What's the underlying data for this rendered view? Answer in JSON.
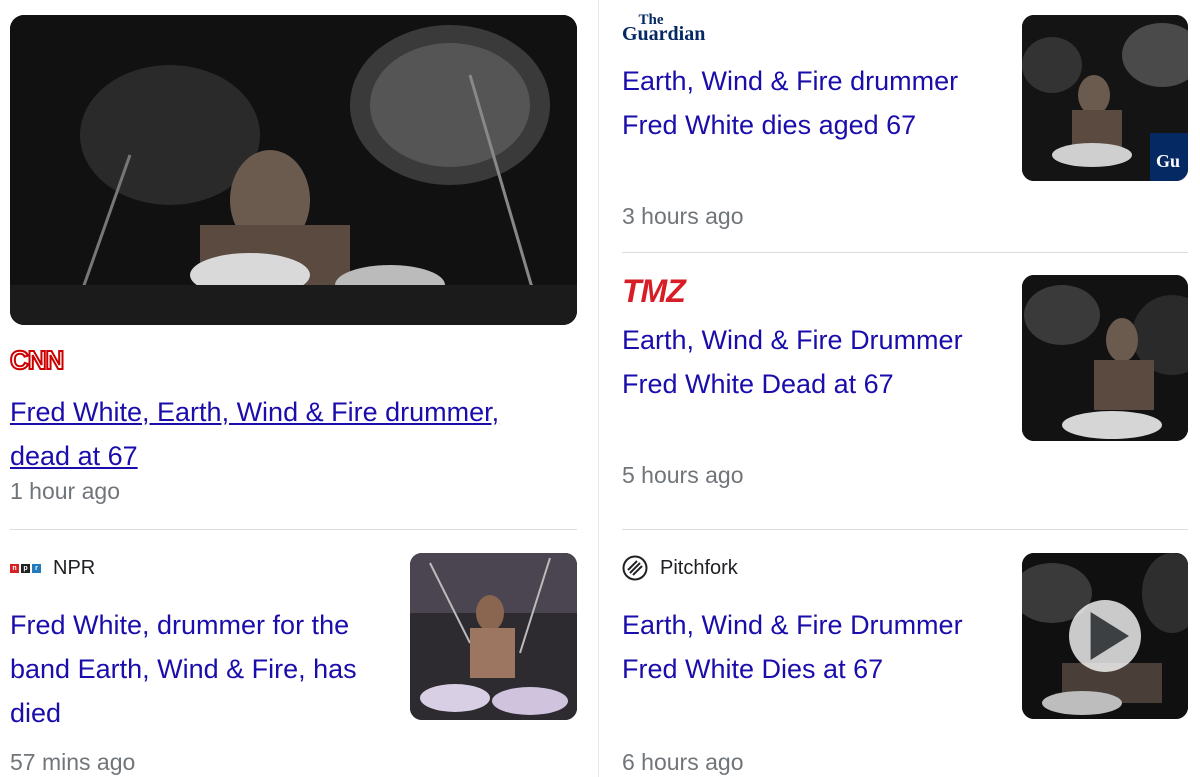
{
  "articles": [
    {
      "source": "CNN",
      "headline": "Fred White, Earth, Wind & Fire drummer, dead at 67",
      "time": "1 hour ago",
      "thumbnail": "drummer-photo-bw-large"
    },
    {
      "source": "NPR",
      "headline": "Fred White, drummer for the band Earth, Wind & Fire, has died",
      "time": "57 mins ago",
      "thumbnail": "drummer-photo-color"
    },
    {
      "source": "The Guardian",
      "headline": "Earth, Wind & Fire drummer Fred White dies aged 67",
      "time": "3 hours ago",
      "thumbnail": "drummer-photo-bw"
    },
    {
      "source": "TMZ",
      "headline": "Earth, Wind & Fire Drummer Fred White Dead at 67",
      "time": "5 hours ago",
      "thumbnail": "drummer-photo-bw"
    },
    {
      "source": "Pitchfork",
      "headline": "Earth, Wind & Fire Drummer Fred White Dies at 67",
      "time": "6 hours ago",
      "thumbnail": "drummer-photo-bw",
      "has_video": true
    }
  ],
  "logos": {
    "cnn": "CNN",
    "npr_letters": [
      "n",
      "p",
      "r"
    ],
    "guardian_the": "The",
    "guardian_name": "Guardian",
    "tmz": "TMZ",
    "thumb_guardian_mark": "Gu"
  },
  "colors": {
    "link": "#1a0dab",
    "meta": "#70757a",
    "cnn": "#cc0000",
    "tmz": "#d71e27",
    "guardian": "#052962"
  }
}
